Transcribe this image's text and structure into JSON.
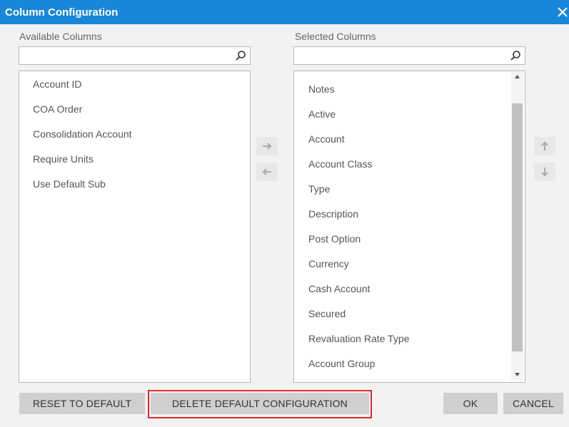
{
  "dialog": {
    "title": "Column Configuration",
    "close_icon": "close-icon"
  },
  "available": {
    "label": "Available Columns",
    "search_value": "",
    "items": [
      "Account ID",
      "COA Order",
      "Consolidation Account",
      "Require Units",
      "Use Default Sub"
    ]
  },
  "selected": {
    "label": "Selected Columns",
    "search_value": "",
    "items": [
      "Notes",
      "Active",
      "Account",
      "Account Class",
      "Type",
      "Description",
      "Post Option",
      "Currency",
      "Cash Account",
      "Secured",
      "Revaluation Rate Type",
      "Account Group"
    ]
  },
  "buttons": {
    "reset": "RESET TO DEFAULT",
    "delete": "DELETE DEFAULT CONFIGURATION",
    "ok": "OK",
    "cancel": "CANCEL"
  },
  "colors": {
    "titlebar": "#1a86d9",
    "highlight_border": "#e32a2a",
    "button_bg": "#cfcfcf"
  }
}
